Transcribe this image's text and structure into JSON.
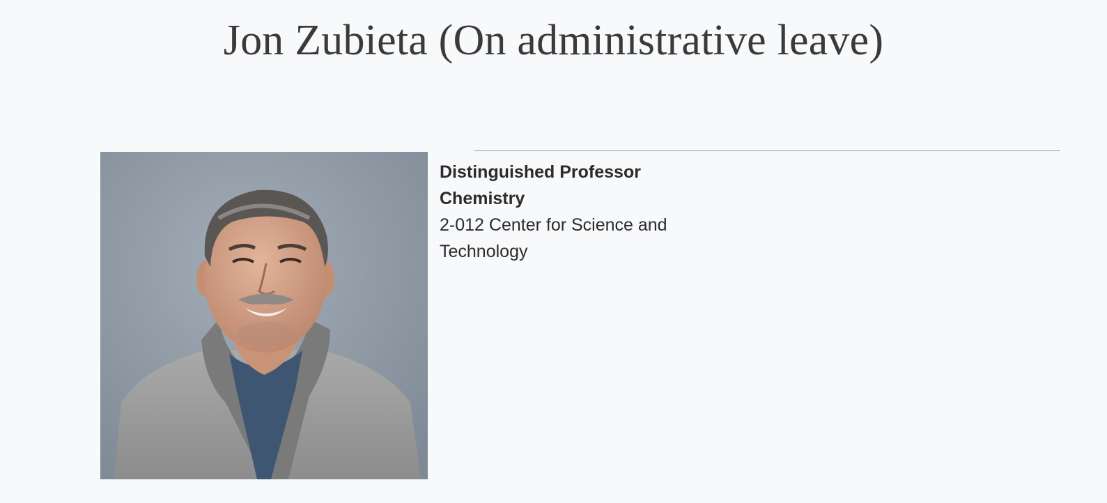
{
  "profile": {
    "name_heading": "Jon Zubieta (On administrative leave)",
    "position_title": "Distinguished Professor",
    "department": "Chemistry",
    "office": "2-012 Center for Science and Technology"
  },
  "colors": {
    "background": "#f8f9fb",
    "heading_text": "#3a3a3a",
    "body_text": "#2b2b2b",
    "divider": "#9a9a9a",
    "photo_backdrop": "#8e98a4"
  }
}
